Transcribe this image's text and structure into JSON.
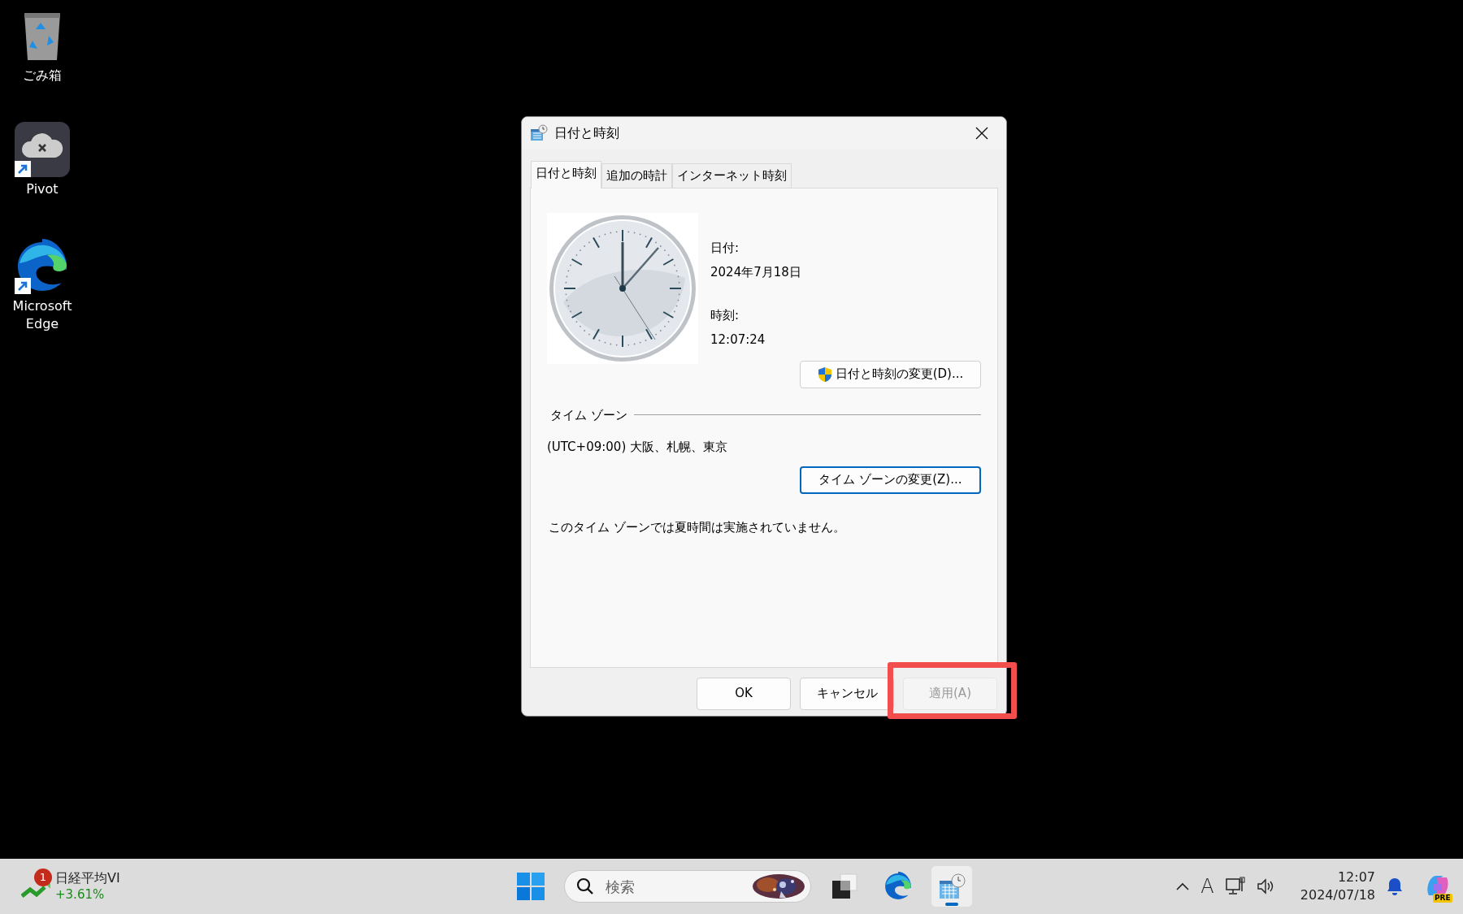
{
  "desktop_icons": [
    {
      "kind": "recycle",
      "label": "ごみ箱",
      "shortcut": false
    },
    {
      "kind": "pivot",
      "label": "Pivot",
      "shortcut": true
    },
    {
      "kind": "edge",
      "label": "Microsoft Edge",
      "shortcut": true
    }
  ],
  "dialog": {
    "title": "日付と時刻",
    "tabs": [
      {
        "label": "日付と時刻",
        "selected": true
      },
      {
        "label": "追加の時計",
        "selected": false
      },
      {
        "label": "インターネット時刻",
        "selected": false
      }
    ],
    "date_label": "日付:",
    "date_value": "2024年7月18日",
    "time_label": "時刻:",
    "time_value": "12:07:24",
    "change_button": "日付と時刻の変更(D)...",
    "timezone_group": "タイム ゾーン",
    "timezone_value": "(UTC+09:00) 大阪、札幌、東京",
    "timezone_button": {
      "label": "タイム ゾーンの変更(Z)...",
      "focused": true
    },
    "dst_note": "このタイム ゾーンでは夏時間は実施されていません。",
    "buttons": [
      {
        "label": "OK",
        "disabled": false,
        "highlighted": false
      },
      {
        "label": "キャンセル",
        "disabled": false,
        "highlighted": false
      },
      {
        "label": "適用(A)",
        "disabled": true,
        "highlighted": true
      }
    ]
  },
  "taskbar": {
    "widget": {
      "badge": "1",
      "title": "日経平均VI",
      "change": "+3.61%"
    },
    "search": {
      "placeholder": "検索"
    },
    "apps": [
      {
        "kind": "task-view",
        "active": false
      },
      {
        "kind": "edge",
        "active": false
      },
      {
        "kind": "datetime",
        "active": true
      }
    ],
    "ime": "A",
    "time": "12:07",
    "date": "2024/07/18",
    "copilot_badge": "PRE"
  }
}
